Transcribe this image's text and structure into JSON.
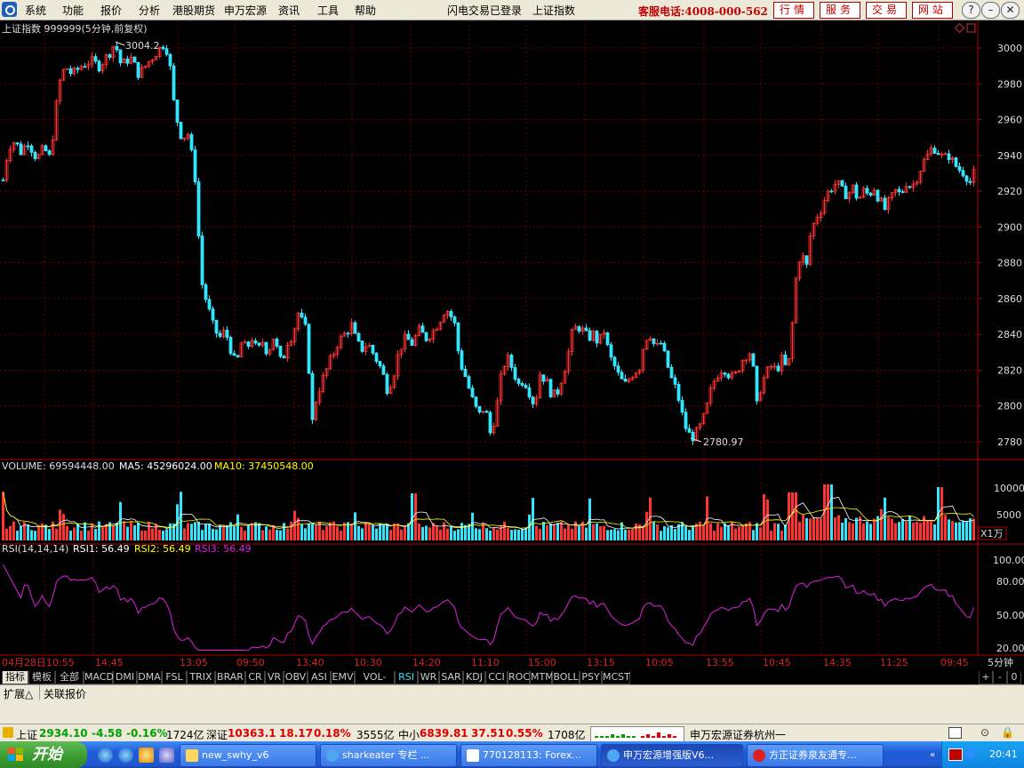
{
  "menubar": {
    "items": [
      "系统",
      "功能",
      "报价",
      "分析",
      "港股期货",
      "申万宏源",
      "资讯",
      "工具",
      "帮助"
    ],
    "status": "闪电交易已登录",
    "index_name": "上证指数",
    "hotline": "客服电话:4008-000-562",
    "buttons": [
      "行情",
      "服务",
      "交易",
      "网站"
    ]
  },
  "chart": {
    "title": "上证指数 999999(5分钟,前复权)",
    "high_label": "3004.2",
    "low_label": "2780.97",
    "y_ticks": [
      "3000",
      "2980",
      "2960",
      "2940",
      "2920",
      "2900",
      "2880",
      "2860",
      "2840",
      "2820",
      "2800",
      "2780"
    ],
    "volume_label": "VOLUME: 69594448.00",
    "ma5_label": "MA5: 45296024.00",
    "ma10_label": "MA10: 37450548.00",
    "volume_ticks": [
      "10000",
      "5000"
    ],
    "volume_unit": "X1万",
    "rsi_label": "RSI(14,14,14)",
    "rsi1_label": "RSI1: 56.49",
    "rsi2_label": "RSI2: 56.49",
    "rsi3_label": "RSI3: 56.49",
    "rsi_ticks": [
      "100.00",
      "80.00",
      "50.00",
      "20.00"
    ],
    "time_labels": [
      "04月28日",
      "10:55",
      "14:45",
      "13:05",
      "09:50",
      "13:40",
      "10:30",
      "14:20",
      "11:10",
      "15:00",
      "13:15",
      "10:05",
      "13:55",
      "10:45",
      "14:35",
      "11:25",
      "09:45"
    ],
    "period": "5分钟",
    "colors": {
      "up": "#ff3333",
      "down": "#33e5ff",
      "axis": "#b00000",
      "rsi": "#e020e0",
      "ma5": "#ffffff",
      "ma10": "#ffff00",
      "grid": "#6a0000"
    }
  },
  "chart_data": {
    "type": "candlestick",
    "symbol": "999999",
    "title": "上证指数 999999(5分钟,前复权)",
    "ylim": [
      2775,
      3010
    ],
    "y_ticks": [
      3000,
      2980,
      2960,
      2940,
      2920,
      2900,
      2880,
      2860,
      2840,
      2820,
      2800,
      2780
    ],
    "marked_high": 3004.2,
    "marked_low": 2780.97,
    "price_path": [
      [
        0,
        2920
      ],
      [
        8,
        2945
      ],
      [
        15,
        2948
      ],
      [
        22,
        2942
      ],
      [
        30,
        2948
      ],
      [
        40,
        2938
      ],
      [
        48,
        2944
      ],
      [
        55,
        2938
      ],
      [
        60,
        2960
      ],
      [
        65,
        2980
      ],
      [
        72,
        2990
      ],
      [
        80,
        2985
      ],
      [
        90,
        2990
      ],
      [
        100,
        2993
      ],
      [
        110,
        2990
      ],
      [
        120,
        2996
      ],
      [
        128,
        3003
      ],
      [
        135,
        2990
      ],
      [
        145,
        2995
      ],
      [
        155,
        2985
      ],
      [
        165,
        2992
      ],
      [
        175,
        2998
      ],
      [
        182,
        3002
      ],
      [
        188,
        2998
      ],
      [
        195,
        2965
      ],
      [
        203,
        2950
      ],
      [
        210,
        2952
      ],
      [
        216,
        2935
      ],
      [
        220,
        2920
      ],
      [
        222,
        2895
      ],
      [
        225,
        2870
      ],
      [
        230,
        2860
      ],
      [
        238,
        2845
      ],
      [
        245,
        2838
      ],
      [
        252,
        2842
      ],
      [
        258,
        2832
      ],
      [
        264,
        2822
      ],
      [
        270,
        2835
      ],
      [
        276,
        2832
      ],
      [
        282,
        2838
      ],
      [
        288,
        2830
      ],
      [
        295,
        2837
      ],
      [
        300,
        2828
      ],
      [
        305,
        2840
      ],
      [
        310,
        2832
      ],
      [
        316,
        2822
      ],
      [
        320,
        2835
      ],
      [
        328,
        2840
      ],
      [
        334,
        2852
      ],
      [
        340,
        2845
      ],
      [
        345,
        2840
      ],
      [
        348,
        2782
      ],
      [
        352,
        2800
      ],
      [
        358,
        2810
      ],
      [
        364,
        2818
      ],
      [
        370,
        2825
      ],
      [
        378,
        2835
      ],
      [
        386,
        2840
      ],
      [
        394,
        2845
      ],
      [
        400,
        2835
      ],
      [
        406,
        2832
      ],
      [
        412,
        2835
      ],
      [
        420,
        2828
      ],
      [
        428,
        2820
      ],
      [
        434,
        2810
      ],
      [
        440,
        2815
      ],
      [
        448,
        2832
      ],
      [
        455,
        2838
      ],
      [
        462,
        2835
      ],
      [
        470,
        2842
      ],
      [
        478,
        2838
      ],
      [
        486,
        2842
      ],
      [
        493,
        2848
      ],
      [
        500,
        2855
      ],
      [
        506,
        2850
      ],
      [
        512,
        2843
      ],
      [
        515,
        2825
      ],
      [
        520,
        2820
      ],
      [
        526,
        2810
      ],
      [
        532,
        2800
      ],
      [
        538,
        2795
      ],
      [
        544,
        2800
      ],
      [
        550,
        2785
      ],
      [
        556,
        2795
      ],
      [
        562,
        2815
      ],
      [
        568,
        2828
      ],
      [
        574,
        2822
      ],
      [
        582,
        2812
      ],
      [
        588,
        2815
      ],
      [
        594,
        2808
      ],
      [
        600,
        2800
      ],
      [
        606,
        2818
      ],
      [
        612,
        2815
      ],
      [
        618,
        2808
      ],
      [
        624,
        2805
      ],
      [
        630,
        2815
      ],
      [
        636,
        2825
      ],
      [
        642,
        2840
      ],
      [
        648,
        2845
      ],
      [
        654,
        2842
      ],
      [
        660,
        2838
      ],
      [
        666,
        2840
      ],
      [
        672,
        2835
      ],
      [
        678,
        2842
      ],
      [
        684,
        2828
      ],
      [
        690,
        2822
      ],
      [
        696,
        2815
      ],
      [
        702,
        2812
      ],
      [
        710,
        2818
      ],
      [
        718,
        2822
      ],
      [
        724,
        2838
      ],
      [
        730,
        2840
      ],
      [
        736,
        2832
      ],
      [
        742,
        2835
      ],
      [
        748,
        2825
      ],
      [
        754,
        2815
      ],
      [
        760,
        2808
      ],
      [
        764,
        2800
      ],
      [
        768,
        2790
      ],
      [
        772,
        2786
      ],
      [
        776,
        2782
      ],
      [
        782,
        2785
      ],
      [
        788,
        2790
      ],
      [
        794,
        2800
      ],
      [
        800,
        2812
      ],
      [
        806,
        2818
      ],
      [
        812,
        2822
      ],
      [
        818,
        2818
      ],
      [
        824,
        2815
      ],
      [
        830,
        2822
      ],
      [
        836,
        2828
      ],
      [
        842,
        2830
      ],
      [
        846,
        2820
      ],
      [
        850,
        2800
      ],
      [
        854,
        2810
      ],
      [
        860,
        2818
      ],
      [
        866,
        2822
      ],
      [
        872,
        2820
      ],
      [
        878,
        2826
      ],
      [
        884,
        2820
      ],
      [
        888,
        2830
      ],
      [
        892,
        2862
      ],
      [
        896,
        2880
      ],
      [
        900,
        2885
      ],
      [
        906,
        2878
      ],
      [
        910,
        2895
      ],
      [
        916,
        2905
      ],
      [
        922,
        2910
      ],
      [
        928,
        2918
      ],
      [
        934,
        2922
      ],
      [
        940,
        2925
      ],
      [
        946,
        2920
      ],
      [
        952,
        2918
      ],
      [
        958,
        2922
      ],
      [
        964,
        2915
      ],
      [
        970,
        2920
      ],
      [
        976,
        2918
      ],
      [
        982,
        2922
      ],
      [
        988,
        2915
      ],
      [
        994,
        2910
      ],
      [
        1000,
        2915
      ],
      [
        1006,
        2920
      ],
      [
        1012,
        2918
      ],
      [
        1018,
        2925
      ],
      [
        1024,
        2922
      ],
      [
        1030,
        2928
      ],
      [
        1036,
        2935
      ],
      [
        1042,
        2940
      ],
      [
        1048,
        2945
      ],
      [
        1054,
        2942
      ],
      [
        1060,
        2938
      ],
      [
        1066,
        2940
      ],
      [
        1072,
        2935
      ],
      [
        1078,
        2932
      ],
      [
        1084,
        2930
      ],
      [
        1090,
        2925
      ],
      [
        1096,
        2932
      ]
    ],
    "volume": {
      "unit": "万",
      "ticks": [
        10000,
        5000
      ],
      "last": 69594448.0,
      "ma5": 45296024.0,
      "ma10": 37450548.0
    },
    "rsi": {
      "params": [
        14,
        14,
        14
      ],
      "rsi1": 56.49,
      "rsi2": 56.49,
      "rsi3": 56.49,
      "ticks": [
        100,
        80,
        50,
        20
      ]
    },
    "x_labels": [
      "04月28日",
      "10:55",
      "14:45",
      "13:05",
      "09:50",
      "13:40",
      "10:30",
      "14:20",
      "11:10",
      "15:00",
      "13:15",
      "10:05",
      "13:55",
      "10:45",
      "14:35",
      "11:25",
      "09:45"
    ]
  },
  "indicator_tabs": [
    "指标",
    "模板",
    "全部",
    "MACD",
    "DMI",
    "DMA",
    "FSL",
    "TRIX",
    "BRAR",
    "CR",
    "VR",
    "OBV",
    "ASI",
    "EMV",
    "VOL-TDX",
    "RSI",
    "WR",
    "SAR",
    "KDJ",
    "CCI",
    "ROC",
    "MTM",
    "BOLL",
    "PSY",
    "MCST"
  ],
  "active_indicator": "RSI",
  "ext_tabs": [
    "扩展△",
    "关联报价"
  ],
  "zoom_controls": [
    "+",
    "-",
    "0"
  ],
  "statusbar": {
    "sh_name": "上证",
    "sh_value": "2934.10",
    "sh_change": "-4.58",
    "sh_pct": "-0.16%",
    "sh_amount": "1724亿",
    "sz_name": "深证",
    "sz_value": "10363.1",
    "sz_change": "18.17",
    "sz_pct": "0.18%",
    "sz_amount": "3555亿",
    "zx_name": "中小",
    "zx_value": "6839.81",
    "zx_change": "37.51",
    "zx_pct": "0.55%",
    "zx_amount": "1708亿",
    "broker": "申万宏源证券杭州一"
  },
  "taskbar": {
    "start": "开始",
    "tasks": [
      "new_swhy_v6",
      "sharkeater 专栏 ...",
      "770128113: Forex...",
      "申万宏源增强版V6...",
      "方正证券泉友通专..."
    ],
    "clock": "20:41"
  }
}
